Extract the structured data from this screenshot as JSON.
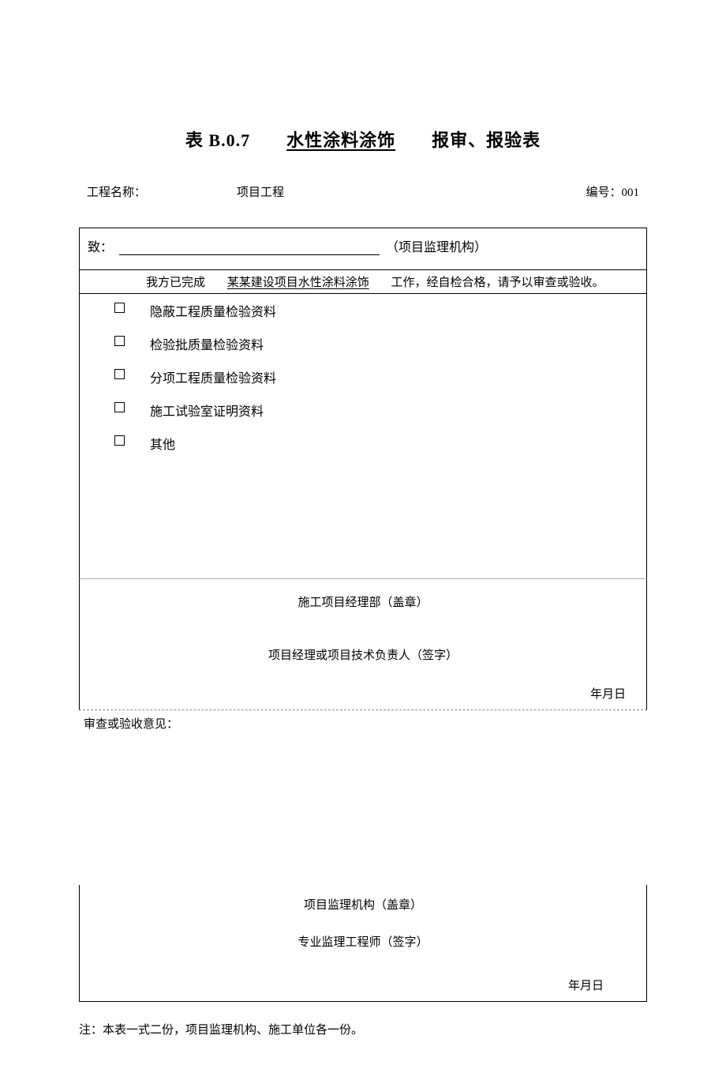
{
  "title": {
    "prefix": "表 B.0.7",
    "subject": "水性涂料涂饰",
    "suffix": "报审、报验表"
  },
  "meta": {
    "project_label": "工程名称：",
    "project_value": "项目工程",
    "doc_no_label": "编号：",
    "doc_no_value": "001"
  },
  "section1": {
    "to_label": "致：",
    "to_suffix": "（项目监理机构）",
    "completed_prefix": "我方已完成",
    "completed_subject": "某某建设项目水性涂料涂饰",
    "completed_suffix": "工作，经自检合格，请予以审查或验收。",
    "checks": [
      "隐蔽工程质量检验资料",
      "检验批质量检验资料",
      "分项工程质量检验资料",
      "施工试验室证明资料",
      "其他"
    ]
  },
  "section2": {
    "line1": "施工项目经理部（盖章）",
    "line2": "项目经理或项目技术负责人（签字）",
    "date": "年月日"
  },
  "section3": {
    "header": "审查或验收意见：",
    "line1": "项目监理机构（盖章）",
    "line2": "专业监理工程师（签字）",
    "date": "年月日"
  },
  "footnote": "注：本表一式二份，项目监理机构、施工单位各一份。"
}
